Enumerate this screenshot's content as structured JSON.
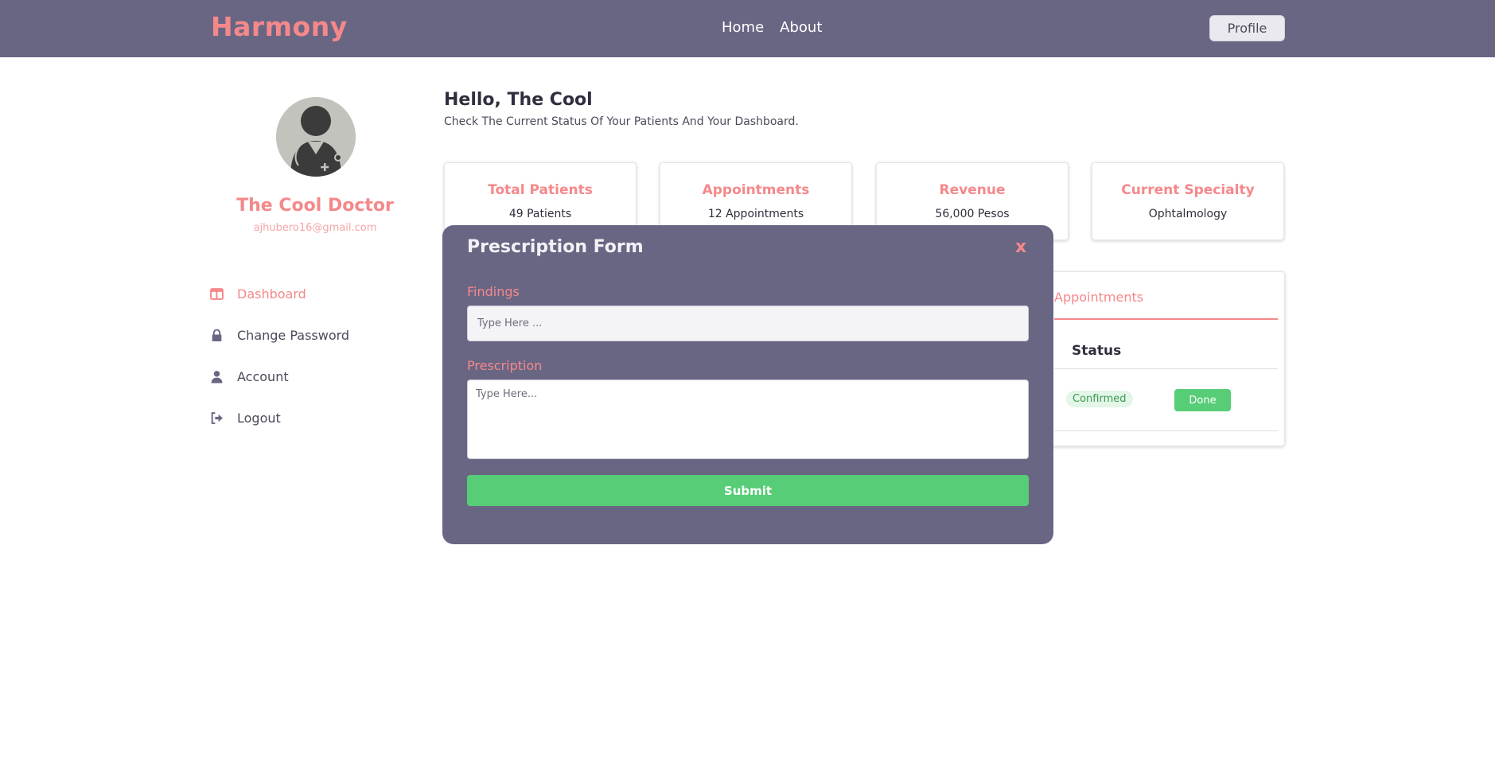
{
  "header": {
    "brand": "Harmony",
    "nav": [
      "Home",
      "About"
    ],
    "profile_label": "Profile"
  },
  "sidebar": {
    "doctor_name": "The Cool Doctor",
    "email": "ajhubero16@gmail.com",
    "items": [
      {
        "label": "Dashboard",
        "icon": "dashboard-icon",
        "active": true
      },
      {
        "label": "Change Password",
        "icon": "lock-icon",
        "active": false
      },
      {
        "label": "Account",
        "icon": "user-icon",
        "active": false
      },
      {
        "label": "Logout",
        "icon": "logout-icon",
        "active": false
      }
    ]
  },
  "main": {
    "greeting": "Hello, The Cool",
    "subtitle": "Check The Current Status Of Your Patients And Your Dashboard.",
    "stats": [
      {
        "label": "Total Patients",
        "value": "49 Patients"
      },
      {
        "label": "Appointments",
        "value": "12 Appointments"
      },
      {
        "label": "Revenue",
        "value": "56,000 Pesos"
      },
      {
        "label": "Current Specialty",
        "value": "Ophtalmology"
      }
    ],
    "appointments_panel": {
      "tab_label": "Appointments",
      "column_status": "Status",
      "row_status": "Confirmed",
      "row_action": "Done"
    }
  },
  "modal": {
    "title": "Prescription Form",
    "close_label": "x",
    "findings_label": "Findings",
    "findings_placeholder": "Type Here ...",
    "prescription_label": "Prescription",
    "prescription_placeholder": "Type Here...",
    "submit_label": "Submit"
  },
  "colors": {
    "header_bg": "#696684",
    "accent": "#f5888a",
    "success": "#57cd77"
  }
}
